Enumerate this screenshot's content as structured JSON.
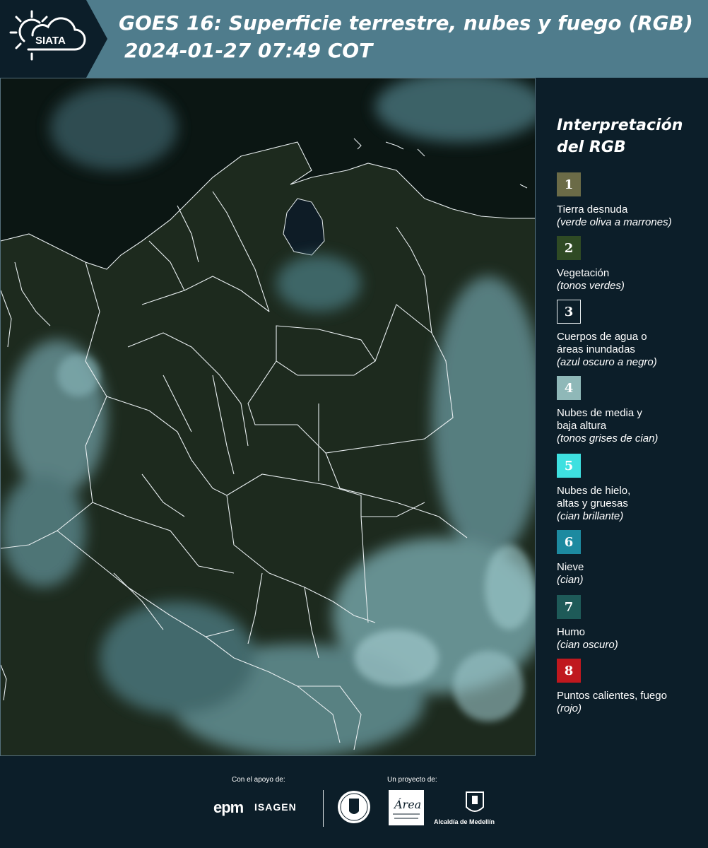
{
  "header": {
    "logo_text": "SIATA",
    "title_line1": "GOES 16: Superficie terrestre, nubes y fuego (RGB)",
    "title_line2": "2024-01-27 07:49 COT"
  },
  "legend": {
    "title": "Interpretación del RGB",
    "items": [
      {
        "number": "1",
        "label": "Tierra desnuda",
        "note": "(verde oliva a marrones)",
        "color": "#6b6b47"
      },
      {
        "number": "2",
        "label": "Vegetación",
        "note": "(tonos verdes)",
        "color": "#2f4a24"
      },
      {
        "number": "3",
        "label": "Cuerpos de agua o\náreas inundadas",
        "note": "(azul oscuro a negro)",
        "color": "#0c1e29"
      },
      {
        "number": "4",
        "label": "Nubes de media y\nbaja altura",
        "note": "(tonos grises de cian)",
        "color": "#8fb8b8"
      },
      {
        "number": "5",
        "label": "Nubes de hielo,\naltas y gruesas",
        "note": "(cian brillante)",
        "color": "#3ee0e0"
      },
      {
        "number": "6",
        "label": "Nieve",
        "note": "(cian)",
        "color": "#1d8aa0"
      },
      {
        "number": "7",
        "label": "Humo",
        "note": "(cian oscuro)",
        "color": "#1e5a58"
      },
      {
        "number": "8",
        "label": "Puntos calientes, fuego",
        "note": "(rojo)",
        "color": "#c0181e"
      }
    ]
  },
  "footer": {
    "support_caption": "Con el apoyo de:",
    "project_caption": "Un proyecto de:",
    "epm": "epm",
    "isagen": "ISAGEN",
    "area_text": "Área",
    "medellin": "Alcaldía de Medellín"
  },
  "colors": {
    "header_bar": "#4f7c8c",
    "background": "#0c1e29",
    "land": "#1f2c20",
    "cloud": "#7fb0b4",
    "border_lines": "#e8eef0"
  }
}
